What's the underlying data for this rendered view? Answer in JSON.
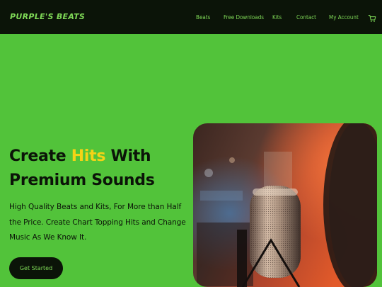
{
  "header": {
    "logo": "PURPLE'S BEATS",
    "nav": [
      "Beats",
      "Free Downloads",
      "Kits",
      "Contact",
      "My Account"
    ],
    "cart_icon": "shopping-cart-icon"
  },
  "hero": {
    "title_before": "Create ",
    "title_highlight": "Hits",
    "title_after": " With",
    "title_line2": "Premium Sounds",
    "subtitle": "High Quality Beats and Kits, For More than Half the Price. Create Chart Topping Hits and Change Music As We Know It.",
    "cta_label": "Get Started",
    "image": "studio-microphone-image"
  },
  "colors": {
    "background": "#52c33a",
    "header": "#0b1408",
    "accent": "#7fd957",
    "highlight": "#f4d316",
    "text": "#0b1408"
  }
}
